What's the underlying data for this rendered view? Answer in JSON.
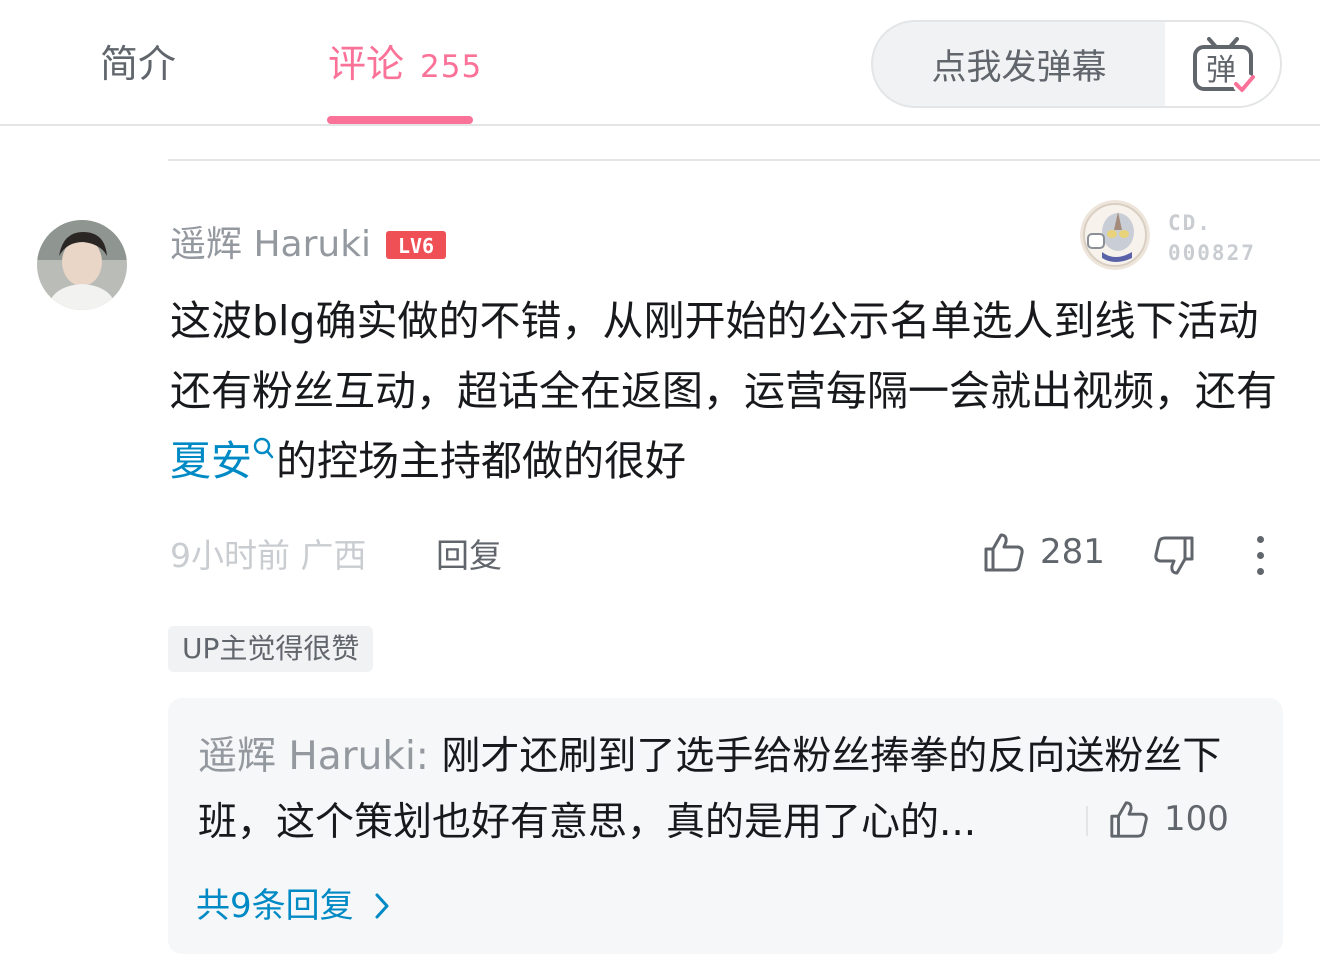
{
  "tabs": {
    "intro": "简介",
    "comments": "评论",
    "comments_count": "255"
  },
  "danmaku": {
    "placeholder": "点我发弹幕",
    "toggle_glyph": "弹"
  },
  "comment": {
    "username": "遥辉 Haruki",
    "level": "LV6",
    "fan_medal": {
      "line1": "CD.",
      "line2": "000827"
    },
    "text_before": "这波blg确实做的不错，从刚开始的公示名单选人到线下活动还有粉丝互动，超话全在返图，运营每隔一会就出视频，还有",
    "link_text": "夏安",
    "text_after": "的控场主持都做的很好",
    "time": "9小时前",
    "location": "广西",
    "reply_label": "回复",
    "like_count": "281",
    "up_badge": "UP主觉得很赞"
  },
  "sub_reply": {
    "username": "遥辉 Haruki:",
    "text": " 刚才还刷到了选手给粉丝捧拳的反向送粉丝下班，这个策划也好有意思，真的是用了心的...",
    "like_count": "100",
    "more_label": "共9条回复"
  },
  "colors": {
    "accent_pink": "#fb7299",
    "link_blue": "#008ac5",
    "level_red": "#ee5055"
  }
}
